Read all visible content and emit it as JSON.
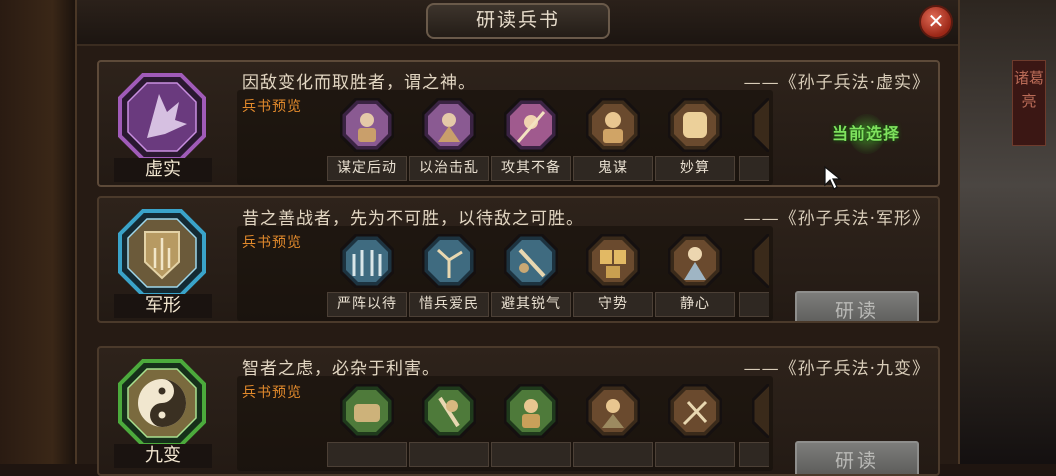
{
  "dialog": {
    "title": "研读兵书",
    "close_glyph": "✕"
  },
  "side_tag": "诸葛亮",
  "books": [
    {
      "name": "虚实",
      "quote": "因敌变化而取胜者，谓之神。",
      "source": "——《孙子兵法·虚实》",
      "preview_label": "兵书预览",
      "status": "当前选择",
      "color": "#a05bb8",
      "tactics": [
        "谋定后动",
        "以治击乱",
        "攻其不备",
        "鬼谋",
        "妙算"
      ]
    },
    {
      "name": "军形",
      "quote": "昔之善战者，先为不可胜，以待敌之可胜。",
      "source": "——《孙子兵法·军形》",
      "preview_label": "兵书预览",
      "button": "研读",
      "color": "#3aa3c9",
      "tactics": [
        "严阵以待",
        "惜兵爱民",
        "避其锐气",
        "守势",
        "静心"
      ]
    },
    {
      "name": "九变",
      "quote": "智者之虑，必杂于利害。",
      "source": "——《孙子兵法·九变》",
      "preview_label": "兵书预览",
      "button": "研读",
      "color": "#4caa3c",
      "tactics": [
        "",
        "",
        "",
        "",
        ""
      ]
    }
  ]
}
